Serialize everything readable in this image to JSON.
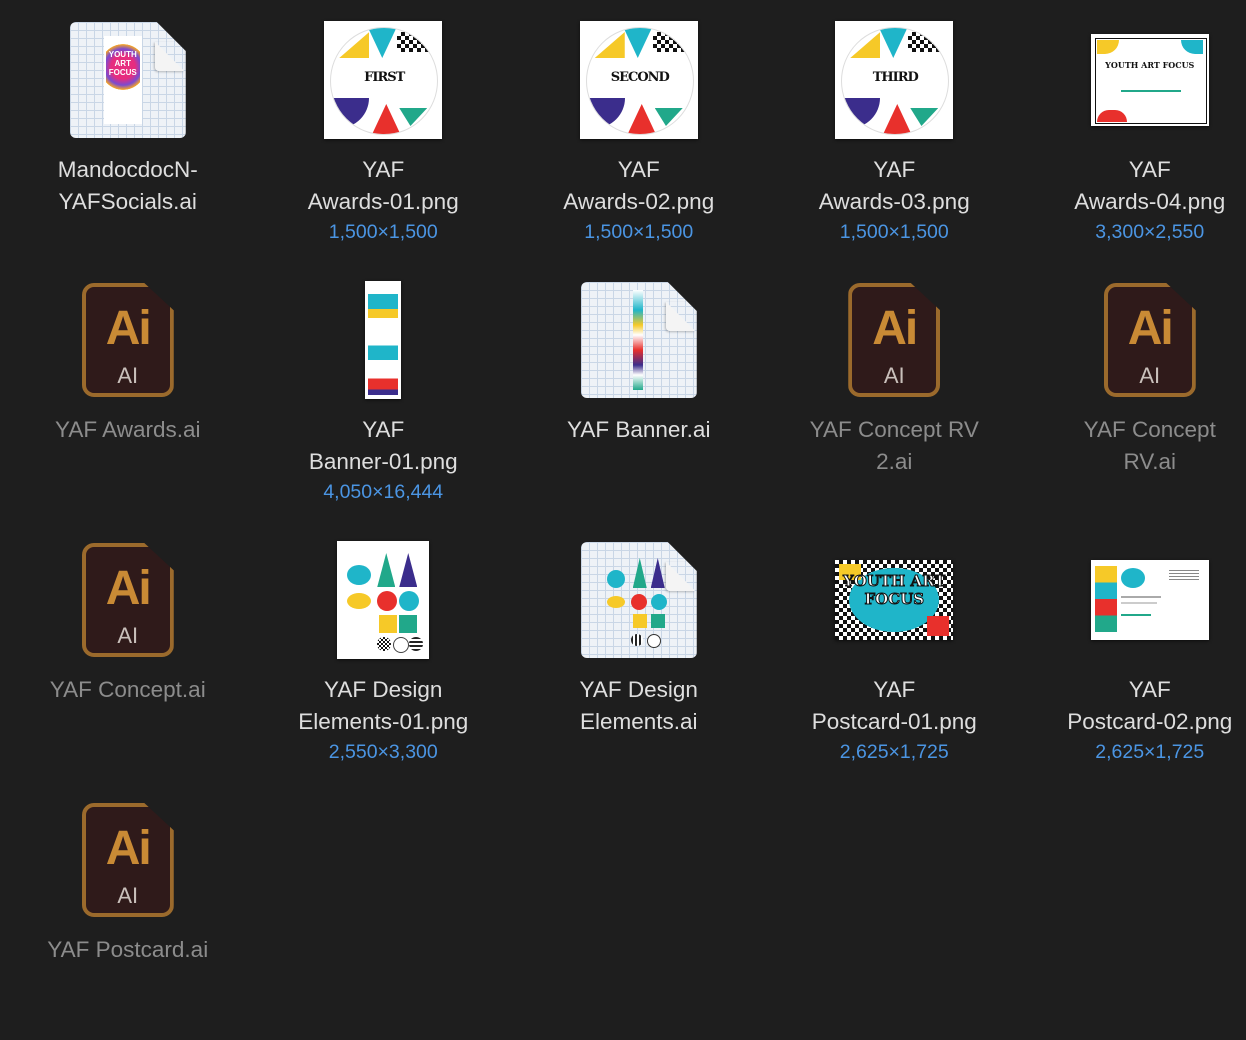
{
  "colors": {
    "background": "#1e1e1e",
    "label": "#dedede",
    "label_dimmed": "#8c8c8c",
    "dimensions": "#4b95e3",
    "ai_orange": "#c98a35",
    "ai_bg": "#2f1a1a"
  },
  "files": [
    {
      "name_lines": [
        "MandocdocN-",
        "YAFSocials.ai"
      ],
      "dimensions": null,
      "icon": "document-preview-icon",
      "kind": "doc-poster",
      "dimmed": false,
      "preview_text": "YOUTH ART FOCUS"
    },
    {
      "name_lines": [
        "YAF",
        "Awards-01.png"
      ],
      "dimensions": "1,500×1,500",
      "icon": "image-thumbnail",
      "kind": "award",
      "dimmed": false,
      "preview_text": "FIRST"
    },
    {
      "name_lines": [
        "YAF",
        "Awards-02.png"
      ],
      "dimensions": "1,500×1,500",
      "icon": "image-thumbnail",
      "kind": "award",
      "dimmed": false,
      "preview_text": "SECOND"
    },
    {
      "name_lines": [
        "YAF",
        "Awards-03.png"
      ],
      "dimensions": "1,500×1,500",
      "icon": "image-thumbnail",
      "kind": "award",
      "dimmed": false,
      "preview_text": "THIRD"
    },
    {
      "name_lines": [
        "YAF",
        "Awards-04.png"
      ],
      "dimensions": "3,300×2,550",
      "icon": "image-thumbnail",
      "kind": "certificate",
      "dimmed": false,
      "preview_text": "YOUTH ART FOCUS"
    },
    {
      "name_lines": [
        "YAF Awards.ai"
      ],
      "dimensions": null,
      "icon": "illustrator-file-icon",
      "kind": "ai",
      "dimmed": true
    },
    {
      "name_lines": [
        "YAF",
        "Banner-01.png"
      ],
      "dimensions": "4,050×16,444",
      "icon": "image-thumbnail",
      "kind": "banner",
      "dimmed": false
    },
    {
      "name_lines": [
        "YAF Banner.ai"
      ],
      "dimensions": null,
      "icon": "document-preview-icon",
      "kind": "doc-banner",
      "dimmed": false
    },
    {
      "name_lines": [
        "YAF Concept RV",
        "2.ai"
      ],
      "dimensions": null,
      "icon": "illustrator-file-icon",
      "kind": "ai",
      "dimmed": true
    },
    {
      "name_lines": [
        "YAF Concept",
        "RV.ai"
      ],
      "dimensions": null,
      "icon": "illustrator-file-icon",
      "kind": "ai",
      "dimmed": true
    },
    {
      "name_lines": [
        "YAF Concept.ai"
      ],
      "dimensions": null,
      "icon": "illustrator-file-icon",
      "kind": "ai",
      "dimmed": true
    },
    {
      "name_lines": [
        "YAF Design",
        "Elements-01.png"
      ],
      "dimensions": "2,550×3,300",
      "icon": "image-thumbnail",
      "kind": "elements",
      "dimmed": false
    },
    {
      "name_lines": [
        "YAF Design",
        "Elements.ai"
      ],
      "dimensions": null,
      "icon": "document-preview-icon",
      "kind": "doc-elements",
      "dimmed": false
    },
    {
      "name_lines": [
        "YAF",
        "Postcard-01.png"
      ],
      "dimensions": "2,625×1,725",
      "icon": "image-thumbnail",
      "kind": "postcard1",
      "dimmed": false,
      "preview_text": "YOUTH ART FOCUS"
    },
    {
      "name_lines": [
        "YAF",
        "Postcard-02.png"
      ],
      "dimensions": "2,625×1,725",
      "icon": "image-thumbnail",
      "kind": "postcard2",
      "dimmed": false
    },
    {
      "name_lines": [
        "YAF Postcard.ai"
      ],
      "dimensions": null,
      "icon": "illustrator-file-icon",
      "kind": "ai",
      "dimmed": true
    }
  ],
  "ai_icon": {
    "big": "Ai",
    "small": "AI"
  }
}
